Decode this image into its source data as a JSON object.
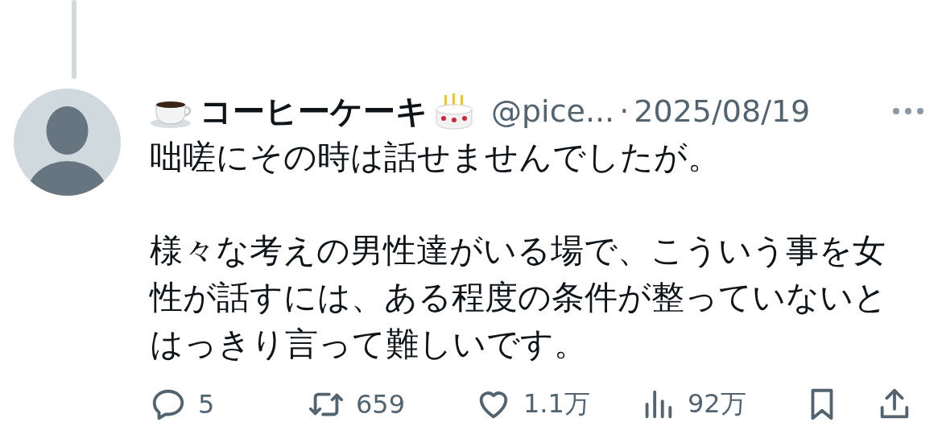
{
  "reply": {
    "display_name": "コーヒーケーキ",
    "handle": "@pice...",
    "separator": "·",
    "date": "2025/08/19",
    "paragraphs": [
      "咄嗟にその時は話せませんでしたが。",
      "様々な考えの男性達がいる場で、こういう事を女性が話すには、ある程度の条件が整っていないとはっきり言って難しいです。"
    ],
    "actions": [
      {
        "kind": "reply",
        "count": "5"
      },
      {
        "kind": "repost",
        "count": "659"
      },
      {
        "kind": "like",
        "count": "1.1万"
      },
      {
        "kind": "views",
        "count": "92万"
      },
      {
        "kind": "bookmark"
      },
      {
        "kind": "share"
      }
    ]
  }
}
